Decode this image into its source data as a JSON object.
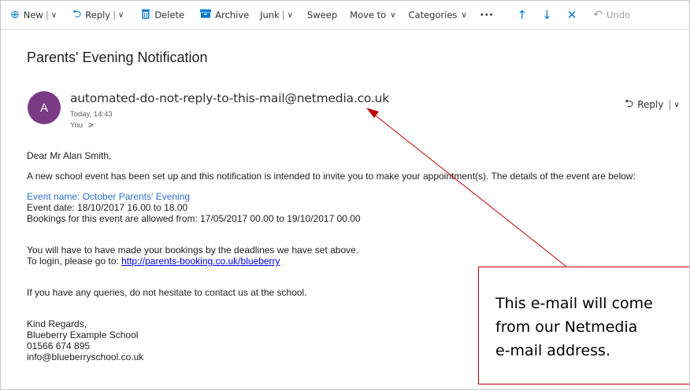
{
  "toolbar": {
    "new_label": "New",
    "reply_label": "Reply",
    "delete_label": "Delete",
    "archive_label": "Archive",
    "junk_label": "Junk",
    "sweep_label": "Sweep",
    "move_label": "Move to",
    "categories_label": "Categories",
    "more_label": "•••",
    "undo_label": "Undo"
  },
  "message": {
    "subject": "Parents' Evening Notification",
    "avatar_initial": "A",
    "sender": "automated-do-not-reply-to-this-mail@netmedia.co.uk",
    "time": "Today, 14:43",
    "to": "You",
    "reply_label": "Reply"
  },
  "body": {
    "greeting": "Dear Mr Alan Smith,",
    "intro": "A new school event has been set up and this notification is intended to invite you to make your appointment(s). The details of the event are below:",
    "event_name": "Event name: October Parents' Evening",
    "event_date": "Event date: 18/10/2017 16.00 to 18.00",
    "bookings": "Bookings for this event are allowed from: 17/05/2017 00.00 to 19/10/2017 00.00",
    "deadline": "You will have to have made your bookings by the deadlines we have set above.",
    "login_prefix": "To login, please go to: ",
    "login_link": "http://parents-booking.co.uk/blueberry",
    "queries": "If you have any queries, do not hesitate to contact us at the school.",
    "sign_regards": "Kind Regards,",
    "sign_school": "Blueberry Example School",
    "sign_phone": "01566 674 895",
    "sign_email": "info@blueberryschool.co.uk"
  },
  "annotation": {
    "line1": "This e-mail will come",
    "line2": "from our Netmedia",
    "line3": "e-mail address."
  },
  "colors": {
    "accent": "#0078d4",
    "avatar": "#7b3a86",
    "annotation": "#c00000",
    "event_name": "#2c70c8"
  }
}
